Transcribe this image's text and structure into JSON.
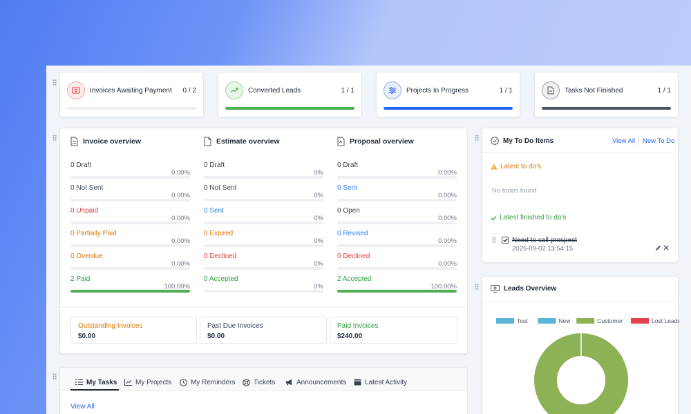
{
  "stats": [
    {
      "label": "Invoices Awaiting Payment",
      "value": "0 / 2",
      "progress": 0,
      "color": "#e53935",
      "icon": "money-icon"
    },
    {
      "label": "Converted Leads",
      "value": "1 / 1",
      "progress": 1,
      "color": "#4caf50",
      "icon": "trend-up-icon"
    },
    {
      "label": "Projects In Progress",
      "value": "1 / 1",
      "progress": 1,
      "color": "#2563eb",
      "icon": "sliders-icon"
    },
    {
      "label": "Tasks Not Finished",
      "value": "1 / 1",
      "progress": 1,
      "color": "#4b5563",
      "icon": "document-icon"
    }
  ],
  "overview": {
    "invoice": {
      "title": "Invoice overview",
      "rows": [
        {
          "label": "0 Draft",
          "pct": "0.00%",
          "progress": 0
        },
        {
          "label": "0 Not Sent",
          "pct": "0.00%",
          "progress": 0
        },
        {
          "label": "0 Unpaid",
          "pct": "0.00%",
          "progress": 0
        },
        {
          "label": "0 Partially Paid",
          "pct": "0.00%",
          "progress": 0
        },
        {
          "label": "0 Overdue",
          "pct": "0.00%",
          "progress": 0
        },
        {
          "label": "2 Paid",
          "pct": "100.00%",
          "progress": 1
        }
      ]
    },
    "estimate": {
      "title": "Estimate overview",
      "rows": [
        {
          "label": "0 Draft",
          "pct": "0%",
          "progress": 0
        },
        {
          "label": "0 Not Sent",
          "pct": "0%",
          "progress": 0
        },
        {
          "label": "0 Sent",
          "pct": "0%",
          "progress": 0
        },
        {
          "label": "0 Expired",
          "pct": "0%",
          "progress": 0
        },
        {
          "label": "0 Declined",
          "pct": "0%",
          "progress": 0
        },
        {
          "label": "0 Accepted",
          "pct": "0%",
          "progress": 0
        }
      ]
    },
    "proposal": {
      "title": "Proposal overview",
      "rows": [
        {
          "label": "0 Draft",
          "pct": "0.00%",
          "progress": 0
        },
        {
          "label": "0 Sent",
          "pct": "0.00%",
          "progress": 0
        },
        {
          "label": "0 Open",
          "pct": "0.00%",
          "progress": 0
        },
        {
          "label": "0 Revised",
          "pct": "0.00%",
          "progress": 0
        },
        {
          "label": "0 Declined",
          "pct": "0.00%",
          "progress": 0
        },
        {
          "label": "2 Accepted",
          "pct": "100.00%",
          "progress": 1
        }
      ]
    },
    "summary": [
      {
        "label": "Outstanding Invoices",
        "value": "$0.00"
      },
      {
        "label": "Past Due Invoices",
        "value": "$0.00"
      },
      {
        "label": "Paid Invoices",
        "value": "$240.00"
      }
    ]
  },
  "todo": {
    "title": "My To Do Items",
    "view_all": "View All",
    "new": "New To Do",
    "latest_label": "Latest to do's",
    "empty": "No todos found",
    "finished_label": "Latest finished to do's",
    "finished_item": {
      "text": "Need to call prospect",
      "date": "2025-09-02 13:54:15"
    }
  },
  "leads": {
    "title": "Leads Overview",
    "legend": [
      {
        "name": "Test",
        "color": "#5bb5d5"
      },
      {
        "name": "New",
        "color": "#5bb5d5"
      },
      {
        "name": "Customer",
        "color": "#8db255"
      },
      {
        "name": "Lost Leads",
        "color": "#e5444f"
      }
    ]
  },
  "chart_data": {
    "type": "pie",
    "title": "",
    "labels": [
      "Test",
      "New",
      "Customer",
      "Lost Leads"
    ],
    "values": [
      0,
      0,
      1,
      0
    ],
    "colors": [
      "#5bb5d5",
      "#5bb5d5",
      "#8db255",
      "#e5444f"
    ],
    "legend_position": "top"
  },
  "tabs": [
    {
      "label": "My Tasks",
      "icon": "list-icon"
    },
    {
      "label": "My Projects",
      "icon": "chart-icon"
    },
    {
      "label": "My Reminders",
      "icon": "clock-icon"
    },
    {
      "label": "Tickets",
      "icon": "lifebuoy-icon"
    },
    {
      "label": "Announcements",
      "icon": "megaphone-icon"
    },
    {
      "label": "Latest Activity",
      "icon": "card-icon"
    }
  ],
  "tasks_view_all": "View All"
}
